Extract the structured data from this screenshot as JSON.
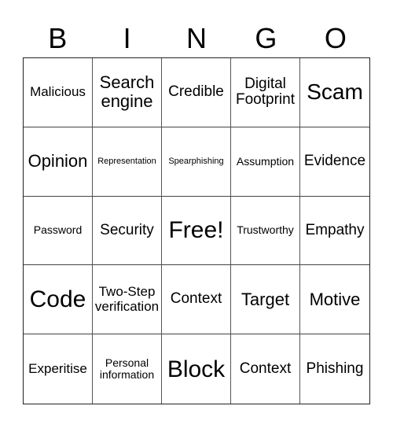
{
  "header": {
    "letters": [
      "B",
      "I",
      "N",
      "G",
      "O"
    ]
  },
  "cells": [
    {
      "text": "Malicious",
      "size": "m"
    },
    {
      "text": "Search engine",
      "size": "xl"
    },
    {
      "text": "Credible",
      "size": "l"
    },
    {
      "text": "Digital Footprint",
      "size": "l"
    },
    {
      "text": "Scam",
      "size": "xxl"
    },
    {
      "text": "Opinion",
      "size": "xl"
    },
    {
      "text": "Representation",
      "size": "xs"
    },
    {
      "text": "Spearphishing",
      "size": "xs"
    },
    {
      "text": "Assumption",
      "size": "s"
    },
    {
      "text": "Evidence",
      "size": "l"
    },
    {
      "text": "Password",
      "size": "s"
    },
    {
      "text": "Security",
      "size": "l"
    },
    {
      "text": "Free!",
      "size": "xxxl"
    },
    {
      "text": "Trustworthy",
      "size": "s"
    },
    {
      "text": "Empathy",
      "size": "l"
    },
    {
      "text": "Code",
      "size": "xxxl"
    },
    {
      "text": "Two-Step verification",
      "size": "m"
    },
    {
      "text": "Context",
      "size": "l"
    },
    {
      "text": "Target",
      "size": "xl"
    },
    {
      "text": "Motive",
      "size": "xl"
    },
    {
      "text": "Experitise",
      "size": "m"
    },
    {
      "text": "Personal information",
      "size": "s"
    },
    {
      "text": "Block",
      "size": "xxxl"
    },
    {
      "text": "Context",
      "size": "l"
    },
    {
      "text": "Phishing",
      "size": "l"
    }
  ]
}
